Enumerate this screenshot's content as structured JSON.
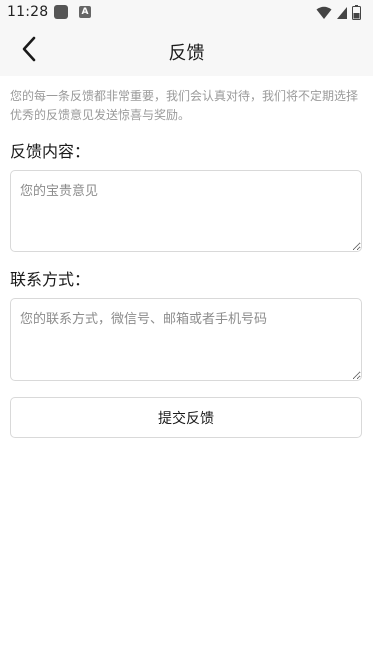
{
  "status_bar": {
    "time": "11:28",
    "notification_icons": [
      "square-icon",
      "a-box-icon"
    ],
    "system_icons": [
      "wifi-icon",
      "signal-icon",
      "battery-icon"
    ]
  },
  "header": {
    "title": "反馈",
    "back_icon": "chevron-left-icon"
  },
  "intro_text": "您的每一条反馈都非常重要，我们会认真对待，我们将不定期选择优秀的反馈意见发送惊喜与奖励。",
  "feedback": {
    "label": "反馈内容：",
    "placeholder": "您的宝贵意见",
    "value": ""
  },
  "contact": {
    "label": "联系方式：",
    "placeholder": "您的联系方式，微信号、邮箱或者手机号码",
    "value": ""
  },
  "submit_label": "提交反馈",
  "colors": {
    "bar_background": "#f7f7f7",
    "border": "#d9d9d9",
    "muted_text": "#9a9a9a"
  }
}
